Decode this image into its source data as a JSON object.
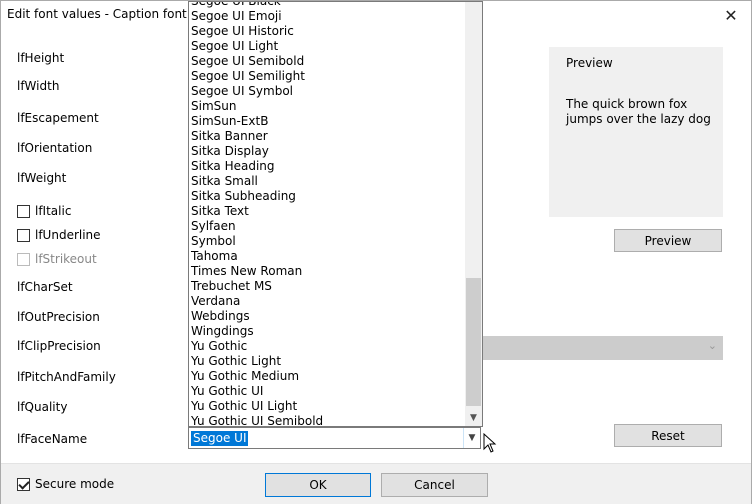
{
  "window": {
    "title": "Edit font values - Caption font",
    "close_glyph": "✕"
  },
  "labels": {
    "lfHeight": "lfHeight",
    "lfWidth": "lfWidth",
    "lfEscapement": "lfEscapement",
    "lfOrientation": "lfOrientation",
    "lfWeight": "lfWeight",
    "lfCharSet": "lfCharSet",
    "lfOutPrecision": "lfOutPrecision",
    "lfClipPrecision": "lfClipPrecision",
    "lfPitchAndFamily": "lfPitchAndFamily",
    "lfQuality": "lfQuality",
    "lfFaceName": "lfFaceName"
  },
  "checkboxes": {
    "italic": {
      "label": "lfItalic",
      "checked": false
    },
    "underline": {
      "label": "lfUnderline",
      "checked": false
    },
    "strikeout": {
      "label": "lfStrikeout",
      "checked": false,
      "disabled": true
    }
  },
  "preview": {
    "heading": "Preview",
    "sample_text": "The quick brown fox jumps over the lazy dog",
    "button_label": "Preview"
  },
  "reset_label": "Reset",
  "facename": {
    "value": "Segoe UI"
  },
  "dropdown": {
    "items": [
      "Segoe UI Black",
      "Segoe UI Emoji",
      "Segoe UI Historic",
      "Segoe UI Light",
      "Segoe UI Semibold",
      "Segoe UI Semilight",
      "Segoe UI Symbol",
      "SimSun",
      "SimSun-ExtB",
      "Sitka Banner",
      "Sitka Display",
      "Sitka Heading",
      "Sitka Small",
      "Sitka Subheading",
      "Sitka Text",
      "Sylfaen",
      "Symbol",
      "Tahoma",
      "Times New Roman",
      "Trebuchet MS",
      "Verdana",
      "Webdings",
      "Wingdings",
      "Yu Gothic",
      "Yu Gothic Light",
      "Yu Gothic Medium",
      "Yu Gothic UI",
      "Yu Gothic UI Light",
      "Yu Gothic UI Semibold"
    ]
  },
  "footer": {
    "secure_mode": {
      "label": "Secure mode",
      "checked": true
    },
    "ok_label": "OK",
    "cancel_label": "Cancel"
  },
  "colors": {
    "accent": "#0078d7",
    "panel": "#f0f0f0"
  }
}
